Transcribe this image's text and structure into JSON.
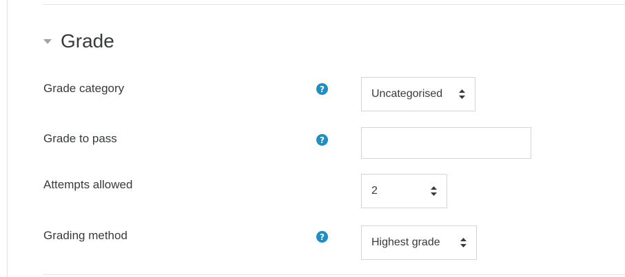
{
  "section": {
    "title": "Grade",
    "collapse_icon": "triangle-down-icon"
  },
  "fields": {
    "grade_category": {
      "label": "Grade category",
      "value": "Uncategorised",
      "help_icon": "question-circle-icon"
    },
    "grade_to_pass": {
      "label": "Grade to pass",
      "value": "",
      "placeholder": "",
      "help_icon": "question-circle-icon"
    },
    "attempts_allowed": {
      "label": "Attempts allowed",
      "value": "2"
    },
    "grading_method": {
      "label": "Grading method",
      "value": "Highest grade",
      "help_icon": "question-circle-icon"
    }
  },
  "colors": {
    "help_icon": "#1f8ec4",
    "text": "#373a3c",
    "border": "#ced4da",
    "collapse_icon": "#a0a4a8"
  }
}
